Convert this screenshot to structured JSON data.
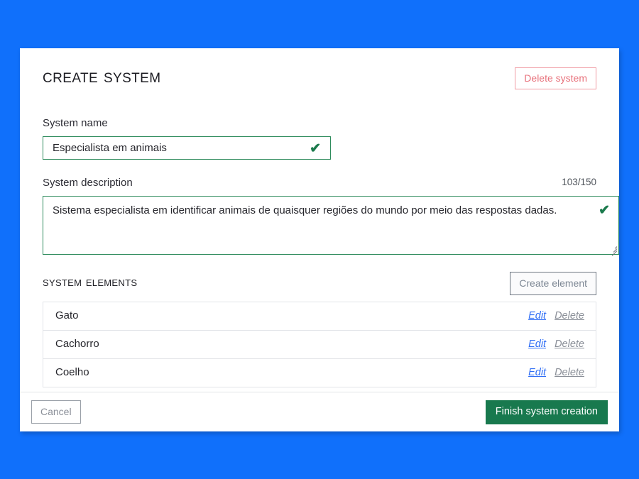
{
  "background_color": "#1070fb",
  "accent": {
    "valid_green": "#2e8b5c",
    "primary_green": "#18794e",
    "danger_red": "#e8737d",
    "link_blue": "#2f6ef5"
  },
  "header": {
    "title": "Create system",
    "delete_system_label": "Delete system"
  },
  "form": {
    "name": {
      "label": "System name",
      "value": "Especialista em animais",
      "placeholder": "",
      "valid_icon": "✔"
    },
    "description": {
      "label": "System description",
      "value": "Sistema especialista em identificar animais de quaisquer regiões do mundo por meio das respostas dadas.",
      "placeholder": "",
      "counter": "103/150",
      "valid_icon": "✔"
    }
  },
  "elements_section": {
    "title": "System elements",
    "create_element_label": "Create element",
    "rows": [
      {
        "name": "Gato",
        "edit": "Edit",
        "delete": "Delete"
      },
      {
        "name": "Cachorro",
        "edit": "Edit",
        "delete": "Delete"
      },
      {
        "name": "Coelho",
        "edit": "Edit",
        "delete": "Delete"
      }
    ]
  },
  "footer": {
    "cancel_label": "Cancel",
    "finish_label": "Finish system creation"
  }
}
